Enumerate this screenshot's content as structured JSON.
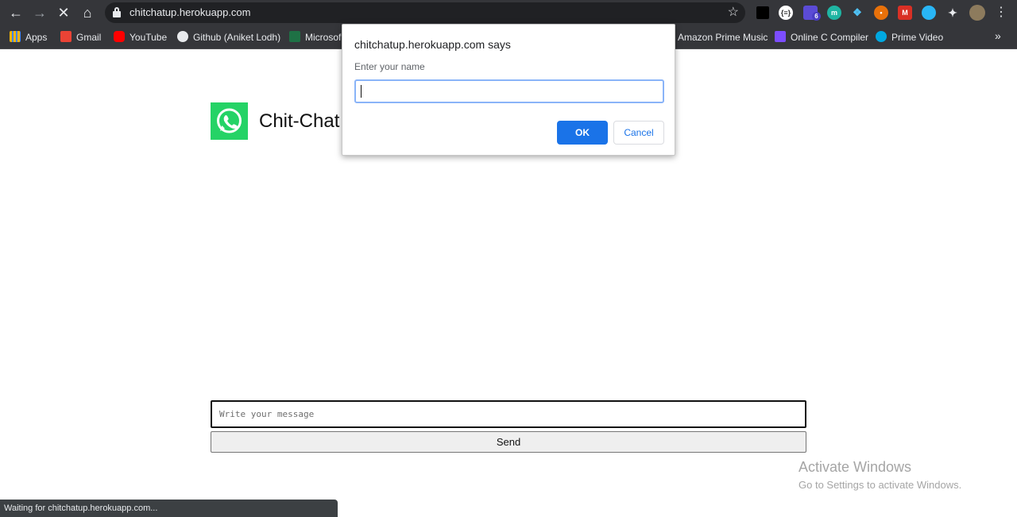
{
  "browser": {
    "url": "chitchatup.herokuapp.com",
    "status_text": "Waiting for chitchatup.herokuapp.com...",
    "ext_badge": "6",
    "bookmarks": [
      {
        "label": "Apps",
        "icon": "apps-grid-icon"
      },
      {
        "label": "Gmail",
        "icon": "gmail-icon"
      },
      {
        "label": "YouTube",
        "icon": "youtube-icon"
      },
      {
        "label": "Github (Aniket Lodh)",
        "icon": "github-icon"
      },
      {
        "label": "Microsof",
        "icon": "excel-icon"
      },
      {
        "label": "Amazon Prime Music",
        "icon": "amazon-music-icon"
      },
      {
        "label": "Online C Compiler",
        "icon": "compiler-icon"
      },
      {
        "label": "Prime Video",
        "icon": "prime-video-icon"
      }
    ],
    "more_label": "»"
  },
  "page": {
    "brand": "Chit-Chat",
    "message_placeholder": "Write your message",
    "send_label": "Send"
  },
  "dialog": {
    "title": "chitchatup.herokuapp.com says",
    "message": "Enter your name",
    "input_value": "",
    "ok_label": "OK",
    "cancel_label": "Cancel"
  },
  "watermark": {
    "line1": "Activate Windows",
    "line2": "Go to Settings to activate Windows."
  },
  "colors": {
    "chrome_bg": "#35363a",
    "accent": "#1a73e8",
    "whatsapp_green": "#25d366"
  }
}
